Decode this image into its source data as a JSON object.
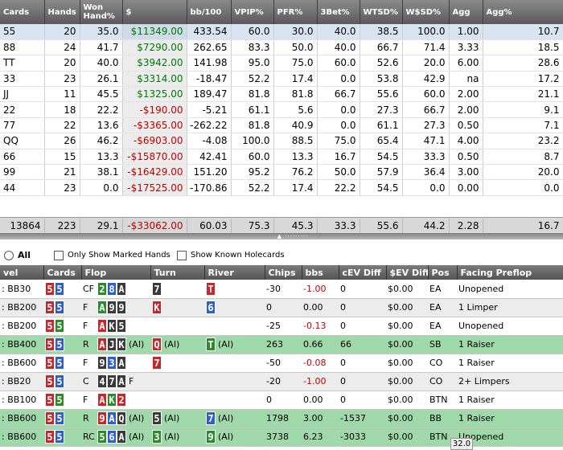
{
  "stats": {
    "headers": [
      "Cards",
      "Hands",
      "Won Hand%",
      "$",
      "bb/100",
      "VPIP%",
      "PFR%",
      "3Bet%",
      "WTSD%",
      "W$SD%",
      "Agg",
      "Agg%"
    ],
    "rows": [
      [
        "55",
        "20",
        "35.0",
        "$11349.00",
        "433.54",
        "60.0",
        "30.0",
        "40.0",
        "38.5",
        "100.0",
        "1.00",
        "10.7"
      ],
      [
        "88",
        "24",
        "41.7",
        "$7290.00",
        "262.65",
        "83.3",
        "50.0",
        "40.0",
        "66.7",
        "71.4",
        "3.33",
        "18.5"
      ],
      [
        "TT",
        "20",
        "40.0",
        "$3942.00",
        "141.98",
        "95.0",
        "75.0",
        "60.0",
        "52.6",
        "20.0",
        "6.00",
        "28.6"
      ],
      [
        "33",
        "23",
        "26.1",
        "$3314.00",
        "-18.47",
        "52.2",
        "17.4",
        "0.0",
        "53.8",
        "42.9",
        "na",
        "17.2"
      ],
      [
        "JJ",
        "11",
        "45.5",
        "$1325.00",
        "189.47",
        "81.8",
        "81.8",
        "66.7",
        "55.6",
        "60.0",
        "2.00",
        "21.1"
      ],
      [
        "22",
        "18",
        "22.2",
        "-$190.00",
        "-5.21",
        "61.1",
        "5.6",
        "0.0",
        "27.3",
        "66.7",
        "2.00",
        "9.1"
      ],
      [
        "77",
        "22",
        "13.6",
        "-$3365.00",
        "-262.22",
        "81.8",
        "40.9",
        "0.0",
        "61.1",
        "27.3",
        "0.50",
        "7.1"
      ],
      [
        "QQ",
        "26",
        "46.2",
        "-$6903.00",
        "-4.08",
        "100.0",
        "88.5",
        "75.0",
        "65.4",
        "47.1",
        "4.00",
        "23.2"
      ],
      [
        "66",
        "15",
        "13.3",
        "-$15870.00",
        "42.41",
        "60.0",
        "13.3",
        "16.7",
        "54.5",
        "33.3",
        "0.50",
        "8.7"
      ],
      [
        "99",
        "21",
        "38.1",
        "-$16429.00",
        "151.20",
        "95.2",
        "76.2",
        "50.0",
        "57.9",
        "36.4",
        "3.00",
        "20.0"
      ],
      [
        "44",
        "23",
        "0.0",
        "-$17525.00",
        "-170.86",
        "52.2",
        "17.4",
        "22.2",
        "54.5",
        "0.0",
        "0.00",
        "0.0"
      ]
    ],
    "summary": [
      "13864",
      "223",
      "29.1",
      "-$33062.00",
      "60.03",
      "75.3",
      "45.3",
      "33.3",
      "55.6",
      "44.2",
      "2.28",
      "16.7"
    ]
  },
  "filters": {
    "all_label": "All",
    "marked_label": "Only Show Marked Hands",
    "holecards_label": "Show Known Holecards"
  },
  "hands": {
    "headers": [
      "vel",
      "Cards",
      "Flop",
      "Turn",
      "River",
      "Chips",
      "bbs",
      "cEV Diff",
      "$EV Diff",
      "Pos",
      "Facing Preflop"
    ],
    "rows": [
      {
        "level": ": BB30",
        "cards": [
          [
            "5",
            "h"
          ],
          [
            "5",
            "d"
          ]
        ],
        "pre": "CF",
        "flop": [
          [
            "2",
            "c"
          ],
          [
            "8",
            "d"
          ],
          [
            "A",
            "s"
          ]
        ],
        "flop_ai": "",
        "turn": [
          [
            "7",
            "s"
          ]
        ],
        "turn_ai": "",
        "river": [
          [
            "T",
            "h"
          ]
        ],
        "river_ai": "",
        "chips": "-30",
        "bbs": "-1.00",
        "cev": "0",
        "sev": "$0.00",
        "pos": "EA",
        "facing": "Unopened"
      },
      {
        "level": ": BB200",
        "cards": [
          [
            "5",
            "h"
          ],
          [
            "5",
            "d"
          ]
        ],
        "pre": "F",
        "flop": [
          [
            "A",
            "c"
          ],
          [
            "9",
            "s"
          ],
          [
            "9",
            "s"
          ]
        ],
        "flop_ai": "",
        "turn": [
          [
            "K",
            "h"
          ]
        ],
        "turn_ai": "",
        "river": [
          [
            "6",
            "d"
          ]
        ],
        "river_ai": "",
        "chips": "0",
        "bbs": "0.00",
        "cev": "0",
        "sev": "$0.00",
        "pos": "EA",
        "facing": "1 Limper"
      },
      {
        "level": ": BB200",
        "cards": [
          [
            "5",
            "h"
          ],
          [
            "5",
            "c"
          ]
        ],
        "pre": "F",
        "flop": [
          [
            "A",
            "h"
          ],
          [
            "K",
            "s"
          ],
          [
            "5",
            "s"
          ]
        ],
        "flop_ai": "",
        "turn": [],
        "turn_ai": "",
        "river": [],
        "river_ai": "",
        "chips": "-25",
        "bbs": "-0.13",
        "cev": "0",
        "sev": "$0.00",
        "pos": "EA",
        "facing": "Unopened"
      },
      {
        "level": ": BB400",
        "cards": [
          [
            "5",
            "h"
          ],
          [
            "5",
            "d"
          ]
        ],
        "pre": "R",
        "flop": [
          [
            "A",
            "h"
          ],
          [
            "J",
            "s"
          ],
          [
            "K",
            "s"
          ]
        ],
        "flop_ai": "(AI)",
        "turn": [
          [
            "Q",
            "h"
          ]
        ],
        "turn_ai": "(AI)",
        "river": [
          [
            "T",
            "c"
          ]
        ],
        "river_ai": "(AI)",
        "chips": "263",
        "bbs": "0.66",
        "cev": "66",
        "sev": "$0.00",
        "pos": "SB",
        "facing": "1 Raiser"
      },
      {
        "level": ": BB600",
        "cards": [
          [
            "5",
            "h"
          ],
          [
            "5",
            "d"
          ]
        ],
        "pre": "F",
        "flop": [
          [
            "9",
            "s"
          ],
          [
            "3",
            "d"
          ],
          [
            "A",
            "s"
          ]
        ],
        "flop_ai": "",
        "turn": [
          [
            "7",
            "h"
          ]
        ],
        "turn_ai": "",
        "river": [],
        "river_ai": "",
        "chips": "-50",
        "bbs": "-0.08",
        "cev": "0",
        "sev": "$0.00",
        "pos": "CO",
        "facing": "1 Raiser"
      },
      {
        "level": ": BB20",
        "cards": [
          [
            "5",
            "h"
          ],
          [
            "5",
            "d"
          ]
        ],
        "pre": "C",
        "flop": [
          [
            "4",
            "s"
          ],
          [
            "7",
            "s"
          ],
          [
            "A",
            "s"
          ]
        ],
        "flop_ai": "F",
        "turn": [],
        "turn_ai": "",
        "river": [],
        "river_ai": "",
        "chips": "-20",
        "bbs": "-1.00",
        "cev": "0",
        "sev": "$0.00",
        "pos": "CO",
        "facing": "2+ Limpers"
      },
      {
        "level": ": BB100",
        "cards": [
          [
            "5",
            "h"
          ],
          [
            "5",
            "c"
          ]
        ],
        "pre": "F",
        "flop": [
          [
            "A",
            "h"
          ],
          [
            "K",
            "c"
          ],
          [
            "2",
            "h"
          ]
        ],
        "flop_ai": "",
        "turn": [],
        "turn_ai": "",
        "river": [],
        "river_ai": "",
        "chips": "0",
        "bbs": "0.00",
        "cev": "0",
        "sev": "$0.00",
        "pos": "BTN",
        "facing": "1 Raiser"
      },
      {
        "level": ": BB600",
        "cards": [
          [
            "5",
            "h"
          ],
          [
            "5",
            "d"
          ]
        ],
        "pre": "R",
        "flop": [
          [
            "9",
            "h"
          ],
          [
            "A",
            "d"
          ],
          [
            "Q",
            "s"
          ]
        ],
        "flop_ai": "(AI)",
        "turn": [
          [
            "5",
            "s"
          ]
        ],
        "turn_ai": "(AI)",
        "river": [
          [
            "7",
            "d"
          ]
        ],
        "river_ai": "(AI)",
        "chips": "1798",
        "bbs": "3.00",
        "cev": "-1537",
        "sev": "$0.00",
        "pos": "BB",
        "facing": "1 Raiser"
      },
      {
        "level": ": BB600",
        "cards": [
          [
            "5",
            "h"
          ],
          [
            "5",
            "d"
          ]
        ],
        "pre": "RC",
        "flop": [
          [
            "5",
            "c"
          ],
          [
            "6",
            "d"
          ],
          [
            "A",
            "s"
          ]
        ],
        "flop_ai": "(AI)",
        "turn": [
          [
            "3",
            "c"
          ]
        ],
        "turn_ai": "(AI)",
        "river": [
          [
            "9",
            "c"
          ]
        ],
        "river_ai": "(AI)",
        "chips": "3738",
        "bbs": "6.23",
        "cev": "-3033",
        "sev": "$0.00",
        "pos": "BTN",
        "facing": "Unopened"
      }
    ]
  },
  "corner_value": "32.0",
  "colors": {
    "positive": "#007a00",
    "negative": "#c00000",
    "highlight": "#9fd8a9",
    "selected": "#d9e4f3"
  }
}
